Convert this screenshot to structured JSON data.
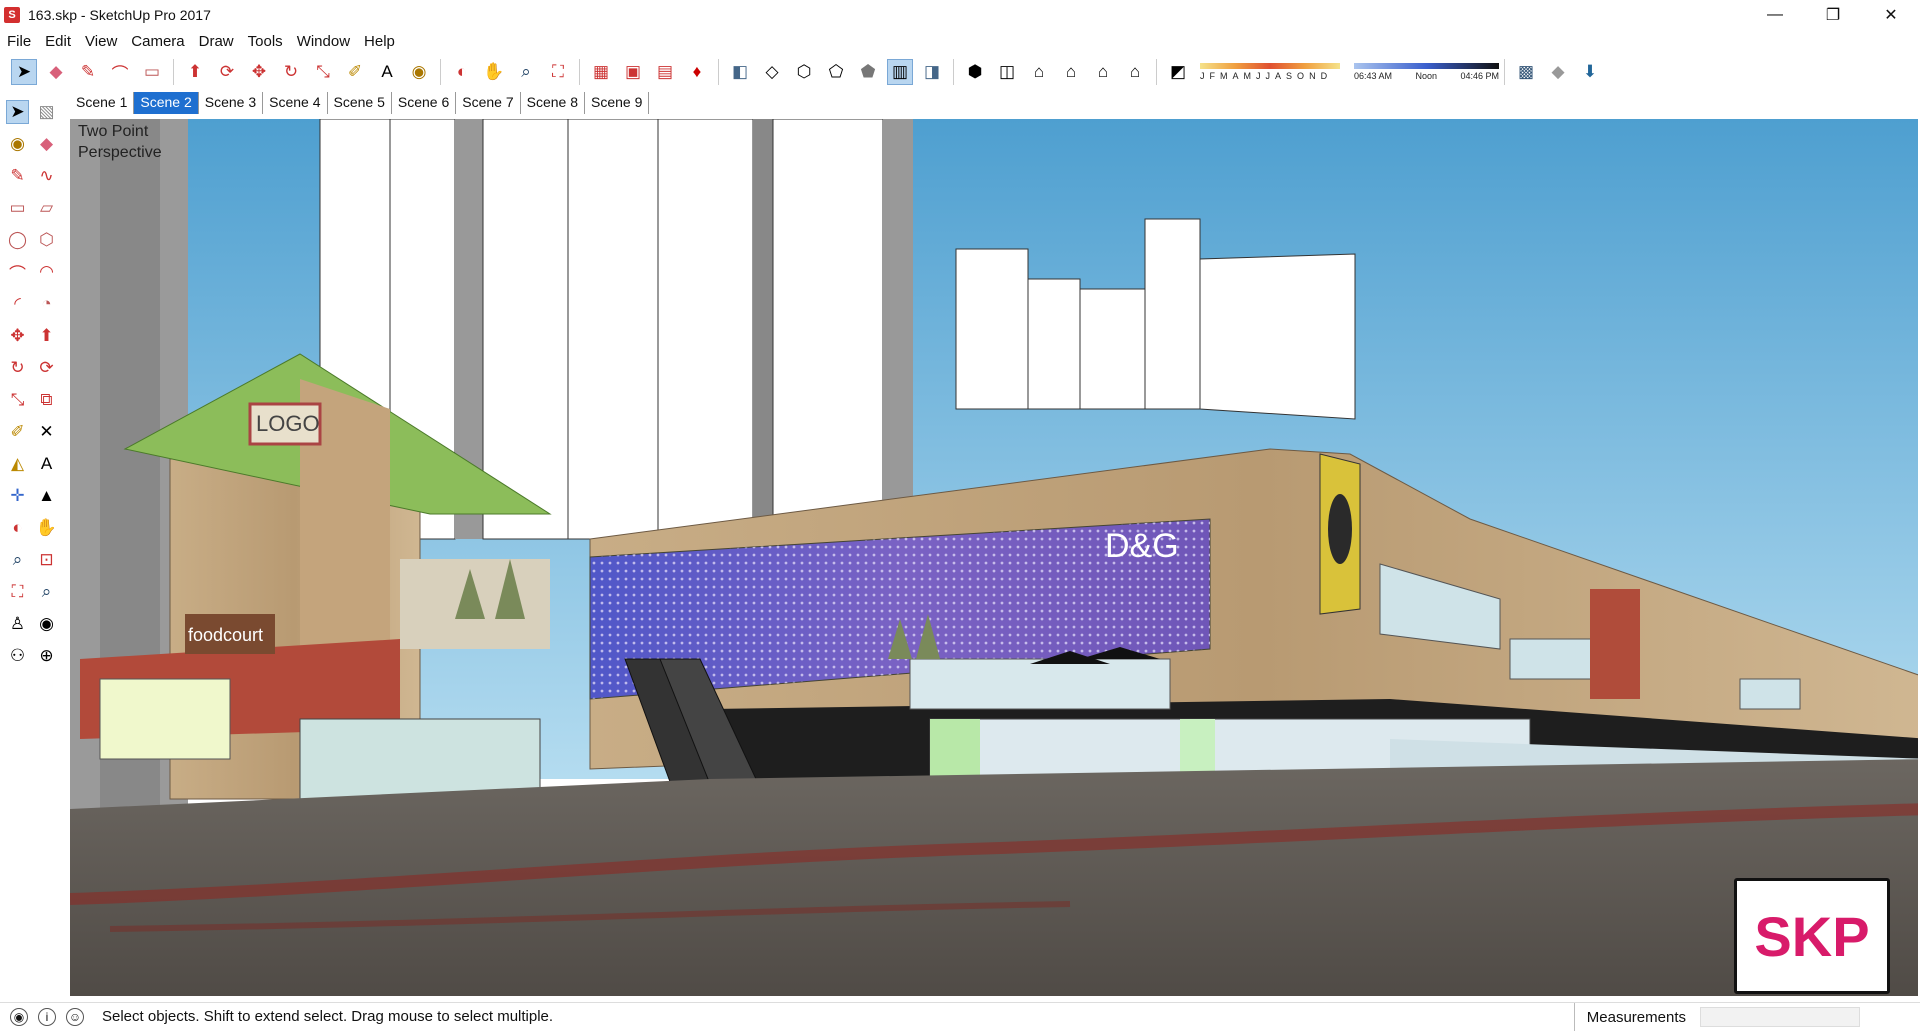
{
  "window": {
    "title": "163.skp - SketchUp Pro 2017",
    "app_icon": "sketchup-icon"
  },
  "window_buttons": [
    "—",
    "❐",
    "✕"
  ],
  "menu": [
    "File",
    "Edit",
    "View",
    "Camera",
    "Draw",
    "Tools",
    "Window",
    "Help"
  ],
  "shadow_widget": {
    "months": [
      "J",
      "F",
      "M",
      "A",
      "M",
      "J",
      "J",
      "A",
      "S",
      "O",
      "N",
      "D"
    ],
    "time_start": "06:43 AM",
    "time_mid": "Noon",
    "time_end": "04:46 PM"
  },
  "scenes": [
    "Scene 1",
    "Scene 2",
    "Scene 3",
    "Scene 4",
    "Scene 5",
    "Scene 6",
    "Scene 7",
    "Scene 8",
    "Scene 9"
  ],
  "active_scene_index": 1,
  "viewport": {
    "camera_label_line1": "Two Point",
    "camera_label_line2": "Perspective",
    "signs": {
      "logo": "LOGO",
      "dg": "D&G",
      "foodcourt": "foodcourt"
    }
  },
  "status": {
    "hint": "Select objects. Shift to extend select. Drag mouse to select multiple.",
    "measurements_label": "Measurements",
    "measurements_value": ""
  },
  "badge": "SKP",
  "colors": {
    "sky_top": "#5ba7d6",
    "sky_bottom": "#a9d4ec",
    "ground": "#5b5651",
    "accent": "#1e6fd0",
    "badge": "#d81b6a"
  }
}
